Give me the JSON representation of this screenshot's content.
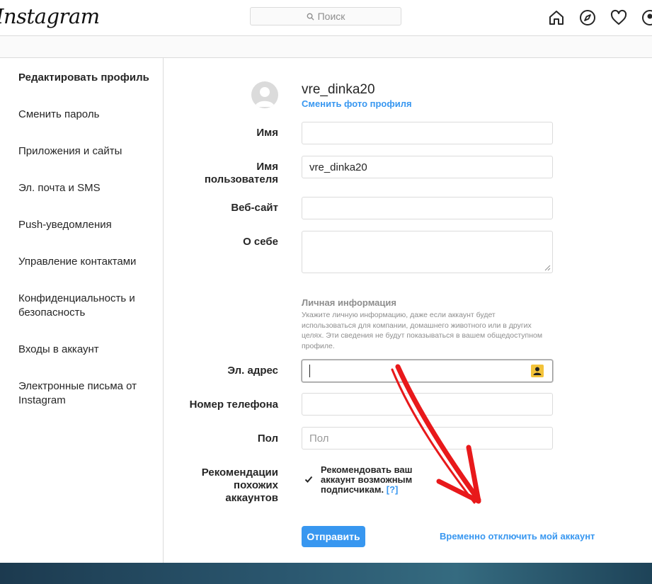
{
  "header": {
    "logo_text": "Instagram",
    "search_placeholder": "Поиск",
    "icons": [
      "home-icon",
      "explore-icon",
      "heart-icon",
      "profile-icon"
    ]
  },
  "sidebar": {
    "items": [
      {
        "label": "Редактировать профиль",
        "active": true
      },
      {
        "label": "Сменить пароль"
      },
      {
        "label": "Приложения и сайты"
      },
      {
        "label": "Эл. почта и SMS"
      },
      {
        "label": "Push-уведомления"
      },
      {
        "label": "Управление контактами"
      },
      {
        "label": "Конфиденциальность и безопасность"
      },
      {
        "label": "Входы в аккаунт"
      },
      {
        "label": "Электронные письма от Instagram"
      }
    ]
  },
  "profile": {
    "username": "vre_dinka20",
    "change_photo": "Сменить фото профиля"
  },
  "form": {
    "name_label": "Имя",
    "name_value": "",
    "username_label": "Имя пользователя",
    "username_value": "vre_dinka20",
    "website_label": "Веб-сайт",
    "website_value": "",
    "bio_label": "О себе",
    "bio_value": "",
    "personal_title": "Личная информация",
    "personal_desc": "Укажите личную информацию, даже если аккаунт будет использоваться для компании, домашнего животного или в других целях. Эти сведения не будут показываться в вашем общедоступном профиле.",
    "email_label": "Эл. адрес",
    "email_value": "",
    "phone_label": "Номер телефона",
    "phone_value": "",
    "gender_label": "Пол",
    "gender_placeholder": "Пол",
    "recommend_label": "Рекомендации похожих аккаунтов",
    "recommend_text": "Рекомендовать ваш аккаунт возможным подписчикам.",
    "recommend_help": "[?]",
    "recommend_checked": true,
    "submit_label": "Отправить",
    "disable_link": "Временно отключить мой аккаунт"
  },
  "colors": {
    "accent": "#3897f0",
    "annotation_arrow": "#e8191b"
  }
}
